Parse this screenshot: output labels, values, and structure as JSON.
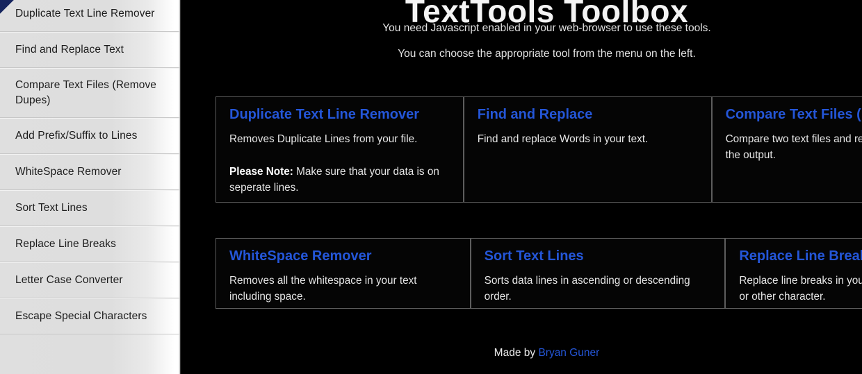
{
  "header": {
    "title": "TextTools Toolbox",
    "subtitle_1": "You need Javascript enabled in your web-browser to use these tools.",
    "subtitle_2": "You can choose the appropriate tool from the menu on the left."
  },
  "sidebar": {
    "items": [
      {
        "label": "Duplicate Text Line Remover"
      },
      {
        "label": "Find and Replace Text"
      },
      {
        "label": "Compare Text Files (Remove Dupes)"
      },
      {
        "label": "Add Prefix/Suffix to Lines"
      },
      {
        "label": "WhiteSpace Remover"
      },
      {
        "label": "Sort Text Lines"
      },
      {
        "label": "Replace Line Breaks"
      },
      {
        "label": "Letter Case Converter"
      },
      {
        "label": "Escape Special Characters"
      }
    ]
  },
  "cards": {
    "row1": [
      {
        "title": "Duplicate Text Line Remover",
        "desc": "Removes Duplicate Lines from your file.",
        "note_label": "Please Note:",
        "note_text": " Make sure that your data is on seperate lines."
      },
      {
        "title": "Find and Replace",
        "desc": "Find and replace Words in your text.",
        "note_label": "",
        "note_text": ""
      },
      {
        "title": "Compare Text Files (Remove Dupes)",
        "desc": "Compare two text files and remove duplicates from the output.",
        "note_label": "",
        "note_text": ""
      }
    ],
    "row2": [
      {
        "title": "WhiteSpace Remover",
        "desc": "Removes all the whitespace in your text including space."
      },
      {
        "title": "Sort Text Lines",
        "desc": "Sorts data lines in ascending or descending order."
      },
      {
        "title": "Replace Line Breaks",
        "desc": "Replace line breaks in your text with a comma or other character."
      }
    ]
  },
  "footer": {
    "made_by": "Made by ",
    "author": "Bryan Guner"
  },
  "colors": {
    "accent_blue": "#2456d8",
    "background": "#000000",
    "sidebar_bg": "#dedede",
    "card_border": "#5d5d5d"
  }
}
